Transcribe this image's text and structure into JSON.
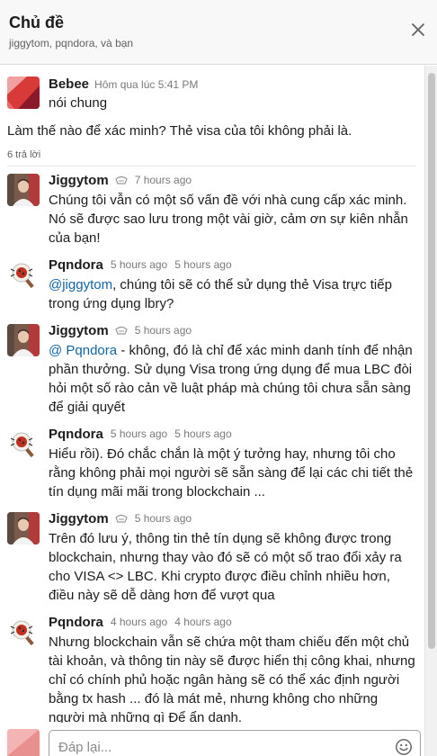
{
  "header": {
    "title": "Chủ đề",
    "subtitle": "jiggytom, pqndora, và bạn"
  },
  "parent": {
    "author": "Bebee",
    "time": "Hôm qua lúc 5:41 PM",
    "channel": "nói chung",
    "body": "Làm thế nào để xác minh? Thẻ visa của tôi không phải là.",
    "reply_count": "6 trả lời"
  },
  "replies": [
    {
      "author": "Jiggytom",
      "time": "7 hours ago",
      "body": "Chúng tôi vẫn có một số vấn đề với nhà cung cấp xác minh. Nó sẽ được sao lưu trong một vài giờ, cảm ơn sự kiên nhẫn của bạn!"
    },
    {
      "author": "Pqndora",
      "time": "5 hours ago",
      "time2": "5 hours ago",
      "mention": "@jiggytom",
      "body": ", chúng tôi sẽ có thể sử dụng thẻ Visa trực tiếp trong ứng dụng lbry?"
    },
    {
      "author": "Jiggytom",
      "time": "5 hours ago",
      "mention": "@ Pqndora",
      "body": " - không, đó là chỉ để xác minh danh tính để nhận phần thưởng. Sử dụng Visa trong ứng dụng để mua LBC đòi hỏi một số rào cản về luật pháp mà chúng tôi chưa sẵn sàng để giải quyết"
    },
    {
      "author": "Pqndora",
      "time": "5 hours ago",
      "time2": "5 hours ago",
      "body": "Hiểu rồi). Đó chắc chắn là một ý tưởng hay, nhưng tôi cho rằng không phải mọi người sẽ sẵn sàng để lại các chi tiết thẻ tín dụng mãi mãi trong blockchain ..."
    },
    {
      "author": "Jiggytom",
      "time": "5 hours ago",
      "body": "Trên đó lưu ý, thông tin thẻ tín dụng sẽ không được trong blockchain, nhưng thay vào đó sẽ có một số trao đổi xảy ra cho VISA <> LBC. Khi crypto được điều chỉnh nhiều hơn, điều này sẽ dễ dàng hơn để vượt qua"
    },
    {
      "author": "Pqndora",
      "time": "4 hours ago",
      "time2": "4 hours ago",
      "body": "Nhưng blockchain vẫn sẽ chứa một tham chiếu đến một chủ tài khoản, và thông tin này sẽ được hiển thị công khai, nhưng chỉ có chính phủ hoặc ngân hàng sẽ có thể xác định người bằng tx hash ... đó là mát mẻ, nhưng không cho những người mà những gì Để ẩn danh."
    }
  ],
  "composer": {
    "placeholder": "Đáp lại..."
  },
  "icons": {
    "close": "close-icon",
    "badge": "bot-badge-icon",
    "emoji": "emoji-icon"
  },
  "colors": {
    "mention": "#1264a3",
    "header_bg": "#f8f8f8"
  }
}
